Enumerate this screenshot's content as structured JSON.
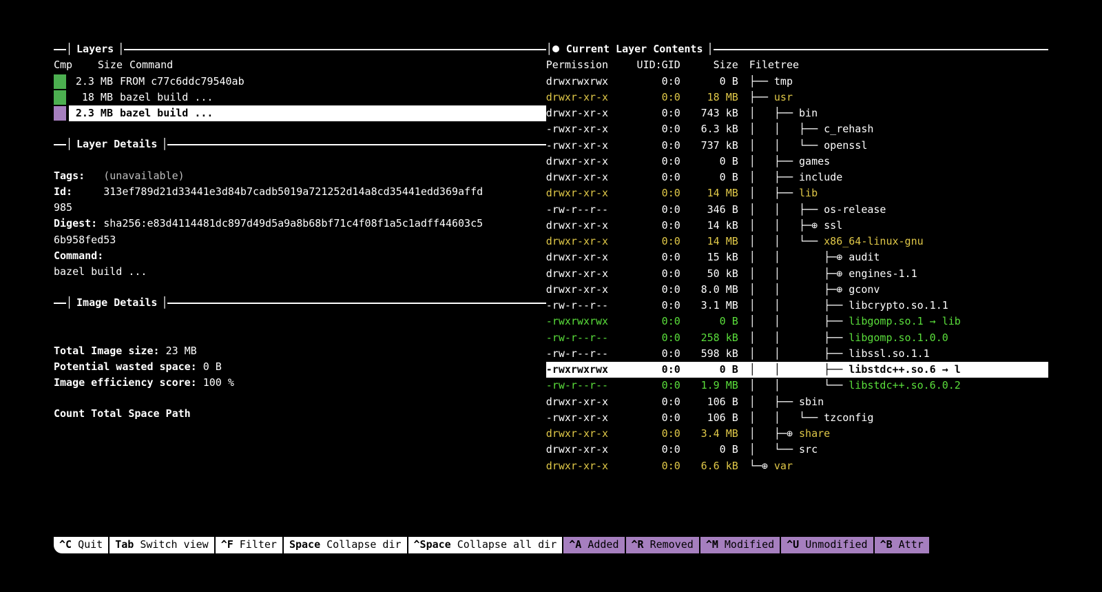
{
  "panels": {
    "layers_title": "Layers",
    "layer_details_title": "Layer Details",
    "image_details_title": "Image Details",
    "current_layer_title": "Current Layer Contents"
  },
  "layer_cols": {
    "cmp": "Cmp",
    "size": "Size",
    "cmd": "Command"
  },
  "layers": [
    {
      "swatch": "green",
      "size": "2.3 MB",
      "cmd": "FROM c77c6ddc79540ab",
      "selected": false
    },
    {
      "swatch": "green",
      "size": "18 MB",
      "cmd": "bazel build ...",
      "selected": false
    },
    {
      "swatch": "purple",
      "size": "2.3 MB",
      "cmd": "bazel build ...",
      "selected": true
    }
  ],
  "details": {
    "tags_k": "Tags:",
    "tags_v": "(unavailable)",
    "id_k": "Id:",
    "id_line1": "313ef789d21d33441e3d84b7cadb5019a721252d14a8cd35441edd369affd",
    "id_line2": "985",
    "digest_k": "Digest:",
    "digest_line1": "sha256:e83d4114481dc897d49d5a9a8b68bf71c4f08f1a5c1adff44603c5",
    "digest_line2": "6b958fed53",
    "command_k": "Command:",
    "command_v": "bazel build ..."
  },
  "image_details": {
    "total_k": "Total Image size:",
    "total_v": "23 MB",
    "wasted_k": "Potential wasted space:",
    "wasted_v": "0 B",
    "eff_k": "Image efficiency score:",
    "eff_v": "100 %",
    "count_header": "Count   Total Space  Path"
  },
  "file_cols": {
    "perm": "Permission",
    "ug": "UID:GID",
    "size": "Size",
    "tree": "Filetree"
  },
  "files": [
    {
      "p": "drwxrwxrwx",
      "ug": "0:0",
      "s": "0 B",
      "tree": "├── ",
      "name": "tmp",
      "cls": ""
    },
    {
      "p": "drwxr-xr-x",
      "ug": "0:0",
      "s": "18 MB",
      "tree": "├── ",
      "name": "usr",
      "cls": "yellow"
    },
    {
      "p": "drwxr-xr-x",
      "ug": "0:0",
      "s": "743 kB",
      "tree": "│   ├── ",
      "name": "bin",
      "cls": ""
    },
    {
      "p": "-rwxr-xr-x",
      "ug": "0:0",
      "s": "6.3 kB",
      "tree": "│   │   ├── ",
      "name": "c_rehash",
      "cls": ""
    },
    {
      "p": "-rwxr-xr-x",
      "ug": "0:0",
      "s": "737 kB",
      "tree": "│   │   └── ",
      "name": "openssl",
      "cls": ""
    },
    {
      "p": "drwxr-xr-x",
      "ug": "0:0",
      "s": "0 B",
      "tree": "│   ├── ",
      "name": "games",
      "cls": ""
    },
    {
      "p": "drwxr-xr-x",
      "ug": "0:0",
      "s": "0 B",
      "tree": "│   ├── ",
      "name": "include",
      "cls": ""
    },
    {
      "p": "drwxr-xr-x",
      "ug": "0:0",
      "s": "14 MB",
      "tree": "│   ├── ",
      "name": "lib",
      "cls": "yellow"
    },
    {
      "p": "-rw-r--r--",
      "ug": "0:0",
      "s": "346 B",
      "tree": "│   │   ├── ",
      "name": "os-release",
      "cls": ""
    },
    {
      "p": "drwxr-xr-x",
      "ug": "0:0",
      "s": "14 kB",
      "tree": "│   │   ├─⊕ ",
      "name": "ssl",
      "cls": ""
    },
    {
      "p": "drwxr-xr-x",
      "ug": "0:0",
      "s": "14 MB",
      "tree": "│   │   └── ",
      "name": "x86_64-linux-gnu",
      "cls": "yellow"
    },
    {
      "p": "drwxr-xr-x",
      "ug": "0:0",
      "s": "15 kB",
      "tree": "│   │       ├─⊕ ",
      "name": "audit",
      "cls": ""
    },
    {
      "p": "drwxr-xr-x",
      "ug": "0:0",
      "s": "50 kB",
      "tree": "│   │       ├─⊕ ",
      "name": "engines-1.1",
      "cls": ""
    },
    {
      "p": "drwxr-xr-x",
      "ug": "0:0",
      "s": "8.0 MB",
      "tree": "│   │       ├─⊕ ",
      "name": "gconv",
      "cls": ""
    },
    {
      "p": "-rw-r--r--",
      "ug": "0:0",
      "s": "3.1 MB",
      "tree": "│   │       ├── ",
      "name": "libcrypto.so.1.1",
      "cls": ""
    },
    {
      "p": "-rwxrwxrwx",
      "ug": "0:0",
      "s": "0 B",
      "tree": "│   │       ├── ",
      "name": "libgomp.so.1 → lib",
      "cls": "green"
    },
    {
      "p": "-rw-r--r--",
      "ug": "0:0",
      "s": "258 kB",
      "tree": "│   │       ├── ",
      "name": "libgomp.so.1.0.0",
      "cls": "green"
    },
    {
      "p": "-rw-r--r--",
      "ug": "0:0",
      "s": "598 kB",
      "tree": "│   │       ├── ",
      "name": "libssl.so.1.1",
      "cls": ""
    },
    {
      "p": "-rwxrwxrwx",
      "ug": "0:0",
      "s": "0 B",
      "tree": "│   │       ├── ",
      "name": "libstdc++.so.6 → l",
      "cls": "",
      "selected": true
    },
    {
      "p": "-rw-r--r--",
      "ug": "0:0",
      "s": "1.9 MB",
      "tree": "│   │       └── ",
      "name": "libstdc++.so.6.0.2",
      "cls": "green"
    },
    {
      "p": "drwxr-xr-x",
      "ug": "0:0",
      "s": "106 B",
      "tree": "│   ├── ",
      "name": "sbin",
      "cls": ""
    },
    {
      "p": "-rwxr-xr-x",
      "ug": "0:0",
      "s": "106 B",
      "tree": "│   │   └── ",
      "name": "tzconfig",
      "cls": ""
    },
    {
      "p": "drwxr-xr-x",
      "ug": "0:0",
      "s": "3.4 MB",
      "tree": "│   ├─⊕ ",
      "name": "share",
      "cls": "yellow"
    },
    {
      "p": "drwxr-xr-x",
      "ug": "0:0",
      "s": "0 B",
      "tree": "│   └── ",
      "name": "src",
      "cls": ""
    },
    {
      "p": "drwxr-xr-x",
      "ug": "0:0",
      "s": "6.6 kB",
      "tree": "└─⊕ ",
      "name": "var",
      "cls": "yellow"
    }
  ],
  "statusbar": {
    "actions": [
      {
        "key": "^C",
        "label": "Quit"
      },
      {
        "key": "Tab",
        "label": "Switch view"
      },
      {
        "key": "^F",
        "label": "Filter"
      },
      {
        "key": "Space",
        "label": "Collapse dir"
      },
      {
        "key": "^Space",
        "label": "Collapse all dir"
      }
    ],
    "legend": [
      {
        "key": "^A",
        "label": "Added"
      },
      {
        "key": "^R",
        "label": "Removed"
      },
      {
        "key": "^M",
        "label": "Modified"
      },
      {
        "key": "^U",
        "label": "Unmodified"
      },
      {
        "key": "^B",
        "label": "Attr"
      }
    ]
  }
}
